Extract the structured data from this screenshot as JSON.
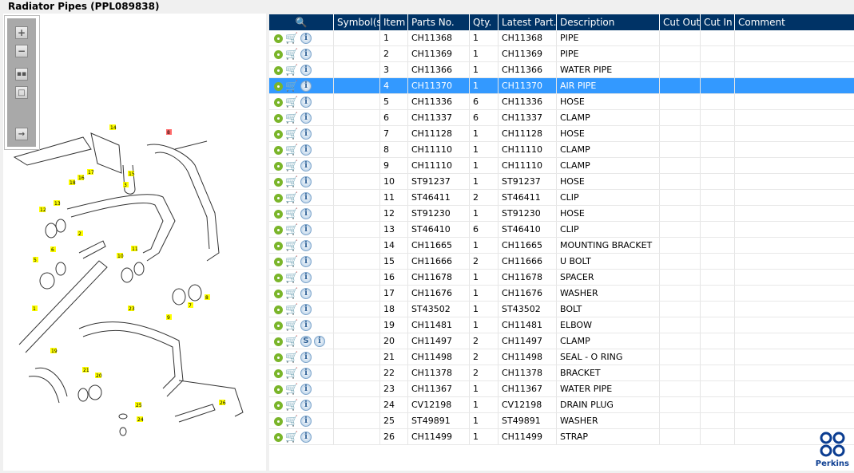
{
  "title": "Radiator Pipes (PPL089838)",
  "toolbar": {
    "zoom_in": "zoom-in",
    "zoom_out": "zoom-out",
    "fit": "fit",
    "actual": "actual-size",
    "toggle": "toggle-panel"
  },
  "columns": [
    "",
    "Symbol(s)",
    "Item",
    "Parts No.",
    "Qty.",
    "Latest Part...",
    "Description",
    "Cut Out",
    "Cut In",
    "Comment"
  ],
  "selected_item": "4",
  "rows": [
    {
      "item": "1",
      "part": "CH11368",
      "qty": "1",
      "latest": "CH11368",
      "desc": "PIPE"
    },
    {
      "item": "2",
      "part": "CH11369",
      "qty": "1",
      "latest": "CH11369",
      "desc": "PIPE"
    },
    {
      "item": "3",
      "part": "CH11366",
      "qty": "1",
      "latest": "CH11366",
      "desc": "WATER PIPE"
    },
    {
      "item": "4",
      "part": "CH11370",
      "qty": "1",
      "latest": "CH11370",
      "desc": "AIR PIPE"
    },
    {
      "item": "5",
      "part": "CH11336",
      "qty": "6",
      "latest": "CH11336",
      "desc": "HOSE"
    },
    {
      "item": "6",
      "part": "CH11337",
      "qty": "6",
      "latest": "CH11337",
      "desc": "CLAMP"
    },
    {
      "item": "7",
      "part": "CH11128",
      "qty": "1",
      "latest": "CH11128",
      "desc": "HOSE"
    },
    {
      "item": "8",
      "part": "CH11110",
      "qty": "1",
      "latest": "CH11110",
      "desc": "CLAMP"
    },
    {
      "item": "9",
      "part": "CH11110",
      "qty": "1",
      "latest": "CH11110",
      "desc": "CLAMP"
    },
    {
      "item": "10",
      "part": "ST91237",
      "qty": "1",
      "latest": "ST91237",
      "desc": "HOSE"
    },
    {
      "item": "11",
      "part": "ST46411",
      "qty": "2",
      "latest": "ST46411",
      "desc": "CLIP"
    },
    {
      "item": "12",
      "part": "ST91230",
      "qty": "1",
      "latest": "ST91230",
      "desc": "HOSE"
    },
    {
      "item": "13",
      "part": "ST46410",
      "qty": "6",
      "latest": "ST46410",
      "desc": "CLIP"
    },
    {
      "item": "14",
      "part": "CH11665",
      "qty": "1",
      "latest": "CH11665",
      "desc": "MOUNTING BRACKET"
    },
    {
      "item": "15",
      "part": "CH11666",
      "qty": "2",
      "latest": "CH11666",
      "desc": "U BOLT"
    },
    {
      "item": "16",
      "part": "CH11678",
      "qty": "1",
      "latest": "CH11678",
      "desc": "SPACER"
    },
    {
      "item": "17",
      "part": "CH11676",
      "qty": "1",
      "latest": "CH11676",
      "desc": "WASHER"
    },
    {
      "item": "18",
      "part": "ST43502",
      "qty": "1",
      "latest": "ST43502",
      "desc": "BOLT"
    },
    {
      "item": "19",
      "part": "CH11481",
      "qty": "1",
      "latest": "CH11481",
      "desc": "ELBOW"
    },
    {
      "item": "20",
      "part": "CH11497",
      "qty": "2",
      "latest": "CH11497",
      "desc": "CLAMP",
      "symbol": "S"
    },
    {
      "item": "21",
      "part": "CH11498",
      "qty": "2",
      "latest": "CH11498",
      "desc": "SEAL - O RING"
    },
    {
      "item": "22",
      "part": "CH11378",
      "qty": "2",
      "latest": "CH11378",
      "desc": "BRACKET"
    },
    {
      "item": "23",
      "part": "CH11367",
      "qty": "1",
      "latest": "CH11367",
      "desc": "WATER PIPE"
    },
    {
      "item": "24",
      "part": "CV12198",
      "qty": "1",
      "latest": "CV12198",
      "desc": "DRAIN PLUG"
    },
    {
      "item": "25",
      "part": "ST49891",
      "qty": "1",
      "latest": "ST49891",
      "desc": "WASHER"
    },
    {
      "item": "26",
      "part": "CH11499",
      "qty": "1",
      "latest": "CH11499",
      "desc": "STRAP"
    }
  ],
  "callouts": [
    "14",
    "8",
    "17",
    "16",
    "18",
    "15",
    "3",
    "13",
    "12",
    "2",
    "6",
    "5",
    "11",
    "10",
    "7",
    "8",
    "9",
    "1",
    "23",
    "19",
    "21",
    "20",
    "25",
    "24",
    "26"
  ],
  "logo": {
    "text": "Perkins"
  },
  "colors": {
    "header": "#003366",
    "selected": "#3399ff",
    "gear": "#7ab52a",
    "highlight_callout": "#ff6b6b",
    "callout": "#ffff00"
  }
}
